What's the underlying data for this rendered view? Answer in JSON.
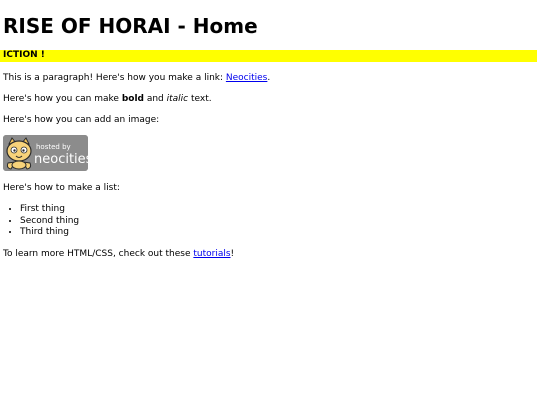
{
  "page": {
    "title": "RISE OF HORAI - Home"
  },
  "marquee": {
    "text": "ICTION !",
    "bg_color": "#ffff00"
  },
  "intro": {
    "text_before": "This is a paragraph! Here's how you make a link: ",
    "link_label": "Neocities",
    "text_after": "."
  },
  "formatting": {
    "text_before": "Here's how you can make ",
    "bold_label": "bold",
    "text_middle": " and ",
    "italic_label": "italic",
    "text_after": " text."
  },
  "image_section": {
    "text": "Here's how you can add an image:",
    "badge_small": "hosted by",
    "badge_big": "neocities"
  },
  "list_section": {
    "text": "Here's how to make a list:",
    "items": [
      "First thing",
      "Second thing",
      "Third thing"
    ]
  },
  "footer": {
    "text_before": "To learn more HTML/CSS, check out these ",
    "link_label": "tutorials",
    "text_after": "!"
  },
  "colors": {
    "link": "#0000ee",
    "badge_bg": "#8c8c8c"
  }
}
